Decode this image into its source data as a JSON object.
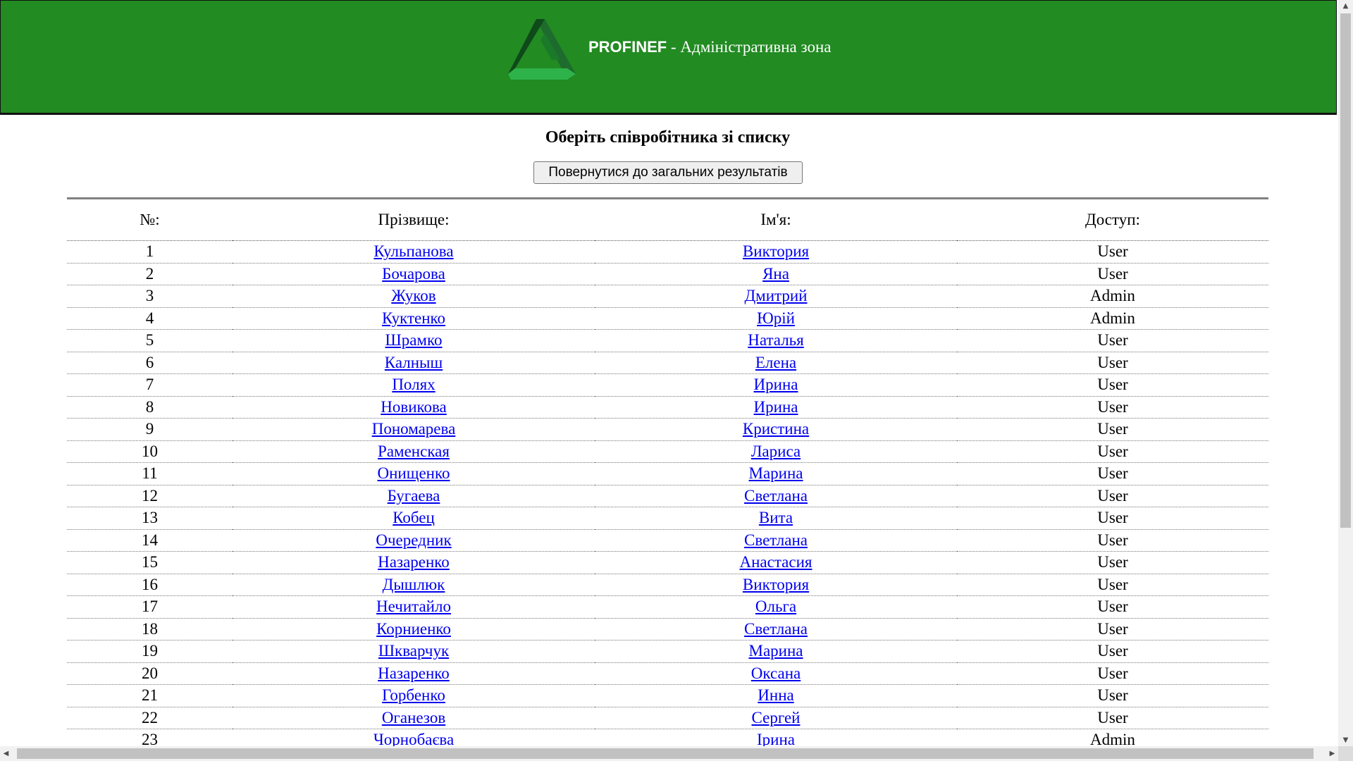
{
  "header": {
    "brand": "PROFINEF",
    "subtitle": " - Адміністративна зона",
    "background_color": "#228b22",
    "logo_icon": "triangle-logo-icon"
  },
  "main": {
    "title": "Оберіть співробітника зі списку",
    "back_button_label": "Повернутися до загальних результатів"
  },
  "table": {
    "columns": [
      "№:",
      "Прізвище:",
      "Ім'я:",
      "Доступ:"
    ],
    "rows": [
      {
        "num": "1",
        "surname": "Кульпанова",
        "name": "Виктория",
        "access": "User"
      },
      {
        "num": "2",
        "surname": "Бочарова",
        "name": "Яна",
        "access": "User"
      },
      {
        "num": "3",
        "surname": "Жуков",
        "name": "Дмитрий",
        "access": "Admin"
      },
      {
        "num": "4",
        "surname": "Куктенко",
        "name": "Юрій",
        "access": "Admin"
      },
      {
        "num": "5",
        "surname": "Шрамко",
        "name": "Наталья",
        "access": "User"
      },
      {
        "num": "6",
        "surname": "Калныш",
        "name": "Елена",
        "access": "User"
      },
      {
        "num": "7",
        "surname": "Полях",
        "name": "Ирина",
        "access": "User"
      },
      {
        "num": "8",
        "surname": "Новикова",
        "name": "Ирина",
        "access": "User"
      },
      {
        "num": "9",
        "surname": "Пономарева",
        "name": "Кристина",
        "access": "User"
      },
      {
        "num": "10",
        "surname": "Раменская",
        "name": "Лариса",
        "access": "User"
      },
      {
        "num": "11",
        "surname": "Онищенко",
        "name": "Марина",
        "access": "User"
      },
      {
        "num": "12",
        "surname": "Бугаева",
        "name": "Светлана",
        "access": "User"
      },
      {
        "num": "13",
        "surname": "Кобец",
        "name": "Вита",
        "access": "User"
      },
      {
        "num": "14",
        "surname": "Очередник",
        "name": "Светлана",
        "access": "User"
      },
      {
        "num": "15",
        "surname": "Назаренко",
        "name": "Анастасия",
        "access": "User"
      },
      {
        "num": "16",
        "surname": "Дышлюк",
        "name": "Виктория",
        "access": "User"
      },
      {
        "num": "17",
        "surname": "Нечитайло",
        "name": "Ольга",
        "access": "User"
      },
      {
        "num": "18",
        "surname": "Корниенко",
        "name": "Светлана",
        "access": "User"
      },
      {
        "num": "19",
        "surname": "Шкварчук",
        "name": "Марина",
        "access": "User"
      },
      {
        "num": "20",
        "surname": "Назаренко",
        "name": "Оксана",
        "access": "User"
      },
      {
        "num": "21",
        "surname": "Горбенко",
        "name": "Инна",
        "access": "User"
      },
      {
        "num": "22",
        "surname": "Оганезов",
        "name": "Сергей",
        "access": "User"
      },
      {
        "num": "23",
        "surname": "Чорнобаєва",
        "name": "Ірина",
        "access": "Admin"
      }
    ]
  },
  "scrollbars": {
    "up_arrow_icon": "scroll-up-arrow-icon",
    "down_arrow_icon": "scroll-down-arrow-icon",
    "left_arrow_icon": "scroll-left-arrow-icon",
    "right_arrow_icon": "scroll-right-arrow-icon"
  },
  "colors": {
    "link": "#0000ee",
    "header_bg": "#228b22",
    "header_text": "#ffffff"
  }
}
